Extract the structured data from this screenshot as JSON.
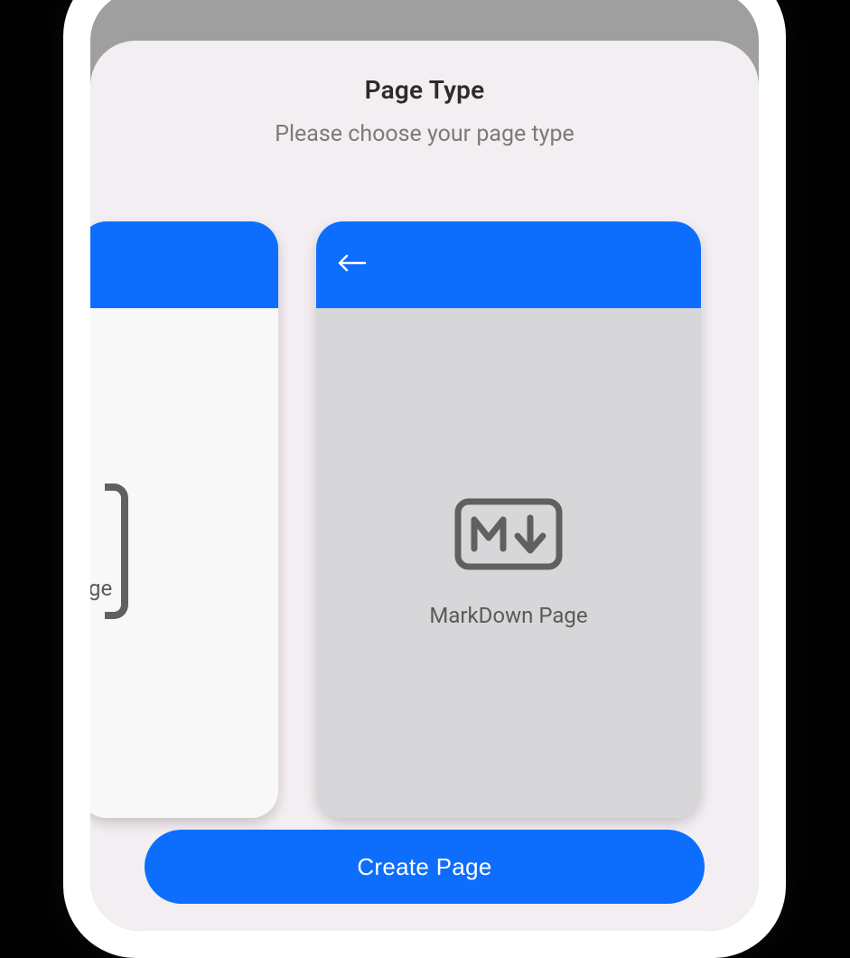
{
  "sheet": {
    "title": "Page Type",
    "subtitle": "Please choose your page type"
  },
  "cards": {
    "left": {
      "label_fragment": "ge"
    },
    "main": {
      "label": "MarkDown Page"
    }
  },
  "actions": {
    "create_label": "Create Page"
  },
  "colors": {
    "accent": "#0d6efd",
    "sheet_bg": "#f3eef2",
    "card_body": "#d7d7d9"
  }
}
